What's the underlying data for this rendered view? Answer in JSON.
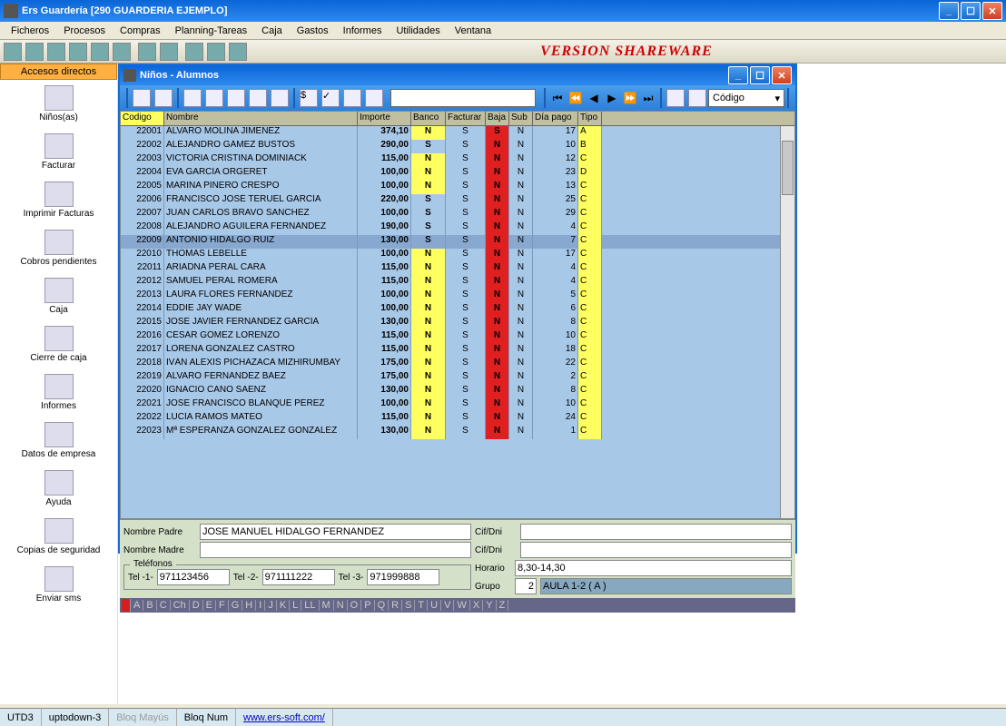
{
  "app": {
    "title": "Ers Guardería [290 GUARDERIA EJEMPLO]"
  },
  "menu": [
    "Ficheros",
    "Procesos",
    "Compras",
    "Planning-Tareas",
    "Caja",
    "Gastos",
    "Informes",
    "Utilidades",
    "Ventana"
  ],
  "shareware": "VERSION SHAREWARE",
  "sidebar": {
    "header": "Accesos directos",
    "items": [
      {
        "label": "Niños(as)"
      },
      {
        "label": "Facturar"
      },
      {
        "label": "Imprimir Facturas"
      },
      {
        "label": "Cobros pendientes"
      },
      {
        "label": "Caja"
      },
      {
        "label": "Cierre de caja"
      },
      {
        "label": "Informes"
      },
      {
        "label": "Datos de empresa"
      },
      {
        "label": "Ayuda"
      },
      {
        "label": "Copias de seguridad"
      },
      {
        "label": "Enviar sms"
      }
    ]
  },
  "child": {
    "title": "Niños - Alumnos",
    "combo": "Código",
    "columns": [
      "Codigo",
      "Nombre",
      "Importe",
      "Banco",
      "Facturar",
      "Baja",
      "Sub",
      "Día pago",
      "Tipo"
    ]
  },
  "rows": [
    {
      "cod": "22001",
      "nom": "ÁLVARO MOLINA JIMENEZ",
      "imp": "374,10",
      "ban": "N",
      "fac": "S",
      "baj": "S",
      "sub": "N",
      "dia": "17",
      "tip": "A"
    },
    {
      "cod": "22002",
      "nom": "ALEJANDRO GÁMEZ BUSTOS",
      "imp": "290,00",
      "ban": "S",
      "fac": "S",
      "baj": "N",
      "sub": "N",
      "dia": "10",
      "tip": "B"
    },
    {
      "cod": "22003",
      "nom": "VICTORIA CRISTINA DOMINIACK",
      "imp": "115,00",
      "ban": "N",
      "fac": "S",
      "baj": "N",
      "sub": "N",
      "dia": "12",
      "tip": "C"
    },
    {
      "cod": "22004",
      "nom": "EVA GARCÍA ORGERET",
      "imp": "100,00",
      "ban": "N",
      "fac": "S",
      "baj": "N",
      "sub": "N",
      "dia": "23",
      "tip": "D"
    },
    {
      "cod": "22005",
      "nom": "MARINA PIÑERO CRESPO",
      "imp": "100,00",
      "ban": "N",
      "fac": "S",
      "baj": "N",
      "sub": "N",
      "dia": "13",
      "tip": "C"
    },
    {
      "cod": "22006",
      "nom": "FRANCISCO JOSÉ TERUEL GARCÍA",
      "imp": "220,00",
      "ban": "S",
      "fac": "S",
      "baj": "N",
      "sub": "N",
      "dia": "25",
      "tip": "C"
    },
    {
      "cod": "22007",
      "nom": "JUAN CARLOS BRAVO SANCHEZ",
      "imp": "100,00",
      "ban": "S",
      "fac": "S",
      "baj": "N",
      "sub": "N",
      "dia": "29",
      "tip": "C"
    },
    {
      "cod": "22008",
      "nom": "ALEJANDRO AGUILERA FERNÁNDEZ",
      "imp": "190,00",
      "ban": "S",
      "fac": "S",
      "baj": "N",
      "sub": "N",
      "dia": "4",
      "tip": "C"
    },
    {
      "cod": "22009",
      "nom": "ANTONIO HIDALGO RUIZ",
      "imp": "130,00",
      "ban": "S",
      "fac": "S",
      "baj": "N",
      "sub": "N",
      "dia": "7",
      "tip": "C",
      "sel": true
    },
    {
      "cod": "22010",
      "nom": "THOMAS LEBELLE",
      "imp": "100,00",
      "ban": "N",
      "fac": "S",
      "baj": "N",
      "sub": "N",
      "dia": "17",
      "tip": "C"
    },
    {
      "cod": "22011",
      "nom": "ARIADNA PERAL CARA",
      "imp": "115,00",
      "ban": "N",
      "fac": "S",
      "baj": "N",
      "sub": "N",
      "dia": "4",
      "tip": "C"
    },
    {
      "cod": "22012",
      "nom": "SAMUEL PERAL ROMERA",
      "imp": "115,00",
      "ban": "N",
      "fac": "S",
      "baj": "N",
      "sub": "N",
      "dia": "4",
      "tip": "C"
    },
    {
      "cod": "22013",
      "nom": "LAURA FLORES FERNÁNDEZ",
      "imp": "100,00",
      "ban": "N",
      "fac": "S",
      "baj": "N",
      "sub": "N",
      "dia": "5",
      "tip": "C"
    },
    {
      "cod": "22014",
      "nom": "EDDIE JAY WADE",
      "imp": "100,00",
      "ban": "N",
      "fac": "S",
      "baj": "N",
      "sub": "N",
      "dia": "6",
      "tip": "C"
    },
    {
      "cod": "22015",
      "nom": "JOSÉ JAVIER FERNÁNDEZ GARCÍA",
      "imp": "130,00",
      "ban": "N",
      "fac": "S",
      "baj": "N",
      "sub": "N",
      "dia": "8",
      "tip": "C"
    },
    {
      "cod": "22016",
      "nom": "CÉSAR GÓMEZ LORENZO",
      "imp": "115,00",
      "ban": "N",
      "fac": "S",
      "baj": "N",
      "sub": "N",
      "dia": "10",
      "tip": "C"
    },
    {
      "cod": "22017",
      "nom": "LORENA GONZALEZ CASTRO",
      "imp": "115,00",
      "ban": "N",
      "fac": "S",
      "baj": "N",
      "sub": "N",
      "dia": "18",
      "tip": "C"
    },
    {
      "cod": "22018",
      "nom": "IVÁN ALEXIS PICHAZACA MIZHIRUMBAY",
      "imp": "175,00",
      "ban": "N",
      "fac": "S",
      "baj": "N",
      "sub": "N",
      "dia": "22",
      "tip": "C"
    },
    {
      "cod": "22019",
      "nom": "ÁLVARO FERNÁNDEZ BÁEZ",
      "imp": "175,00",
      "ban": "N",
      "fac": "S",
      "baj": "N",
      "sub": "N",
      "dia": "2",
      "tip": "C"
    },
    {
      "cod": "22020",
      "nom": "IGNACIO CANO SAENZ",
      "imp": "130,00",
      "ban": "N",
      "fac": "S",
      "baj": "N",
      "sub": "N",
      "dia": "8",
      "tip": "C"
    },
    {
      "cod": "22021",
      "nom": "JOSE FRANCISCO BLANQUE PÉREZ",
      "imp": "100,00",
      "ban": "N",
      "fac": "S",
      "baj": "N",
      "sub": "N",
      "dia": "10",
      "tip": "C"
    },
    {
      "cod": "22022",
      "nom": "LUCÍA RAMOS MATEO",
      "imp": "115,00",
      "ban": "N",
      "fac": "S",
      "baj": "N",
      "sub": "N",
      "dia": "24",
      "tip": "C"
    },
    {
      "cod": "22023",
      "nom": "Mª ESPERANZA GONZALEZ GONZALEZ",
      "imp": "130,00",
      "ban": "N",
      "fac": "S",
      "baj": "N",
      "sub": "N",
      "dia": "1",
      "tip": "C"
    }
  ],
  "detail": {
    "padre_lbl": "Nombre Padre",
    "padre": "JOSE MANUEL HIDALGO FERNANDEZ",
    "madre_lbl": "Nombre Madre",
    "madre": "",
    "cif_lbl": "Cif/Dni",
    "cif1": "",
    "cif2": "",
    "tel_lbl": "Teléfonos",
    "t1_lbl": "Tel -1-",
    "t1": "971123456",
    "t2_lbl": "Tel -2-",
    "t2": "971111222",
    "t3_lbl": "Tel -3-",
    "t3": "971999888",
    "horario_lbl": "Horario",
    "horario": "8,30-14,30",
    "grupo_lbl": "Grupo",
    "grupo_n": "2",
    "grupo_t": "AULA 1-2 ( A )"
  },
  "alpha": [
    "A",
    "B",
    "C",
    "Ch",
    "D",
    "E",
    "F",
    "G",
    "H",
    "I",
    "J",
    "K",
    "L",
    "LL",
    "M",
    "N",
    "O",
    "P",
    "Q",
    "R",
    "S",
    "T",
    "U",
    "V",
    "W",
    "X",
    "Y",
    "Z"
  ],
  "status": {
    "s1": "UTD3",
    "s2": "uptodown-3",
    "s3": "Bloq Mayús",
    "s4": "Bloq Num",
    "url": "www.ers-soft.com/"
  }
}
